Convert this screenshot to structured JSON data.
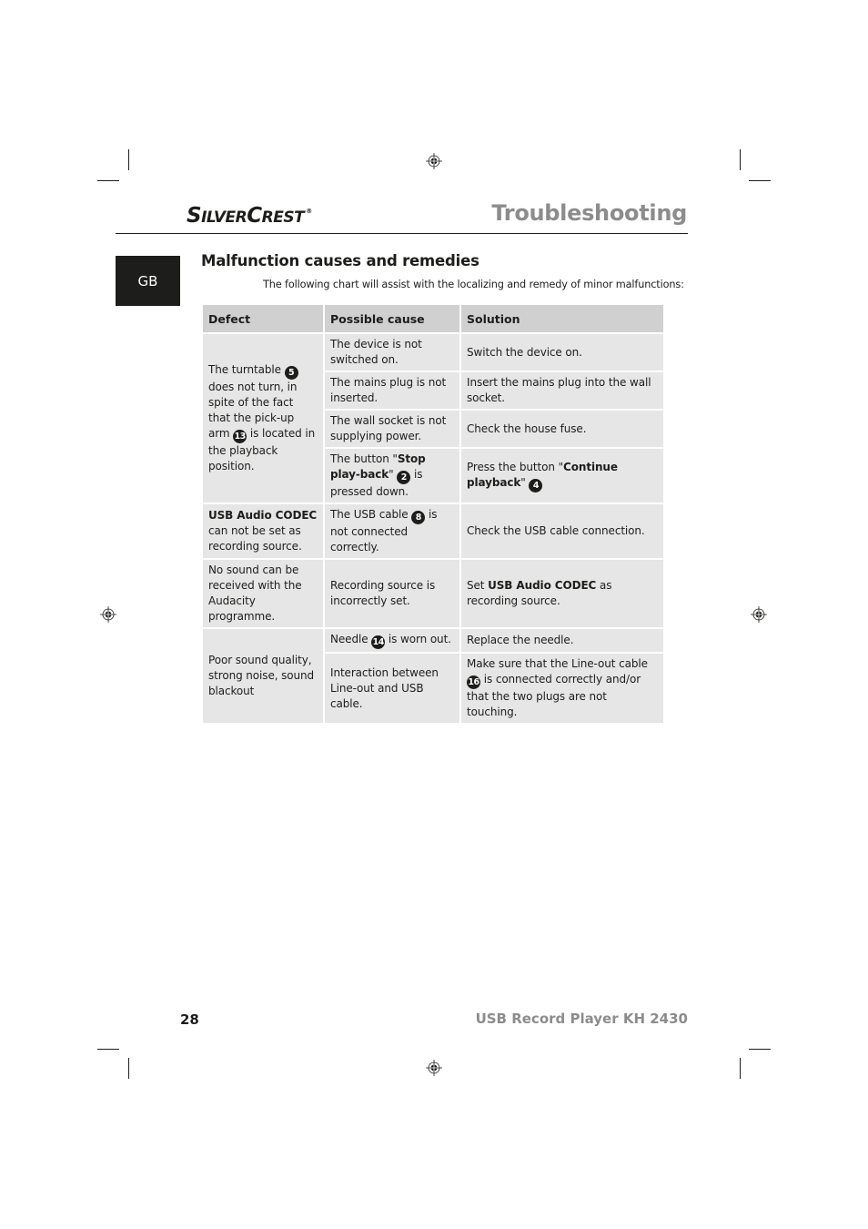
{
  "header": {
    "brand_first_cap": "S",
    "brand_first_rest": "ILVER",
    "brand_second_cap": "C",
    "brand_second_rest": "REST",
    "brand_registered": "®",
    "title": "Troubleshooting"
  },
  "language_tab": "GB",
  "section": {
    "title": "Malfunction causes and remedies",
    "intro": "The following chart will assist with the localizing and remedy of minor malfunctions:"
  },
  "table": {
    "headers": [
      "Defect",
      "Possible cause",
      "Solution"
    ],
    "groups": [
      {
        "defect": {
          "parts": [
            "The turntable ",
            "5",
            " does not turn, in spite of the fact that the pick-up arm ",
            "13",
            " is located in the playback position."
          ]
        },
        "rows": [
          {
            "cause": "The device is not switched on.",
            "solution": "Switch the device on."
          },
          {
            "cause": "The mains plug is not inserted.",
            "solution": "Insert the mains plug into the wall socket."
          },
          {
            "cause": "The wall socket is not supplying power.",
            "solution": "Check the house fuse."
          },
          {
            "cause_parts": [
              "The button \"",
              "Stop play-back",
              "\" ",
              "2",
              " is pressed down."
            ],
            "solution_parts": [
              "Press the button \"",
              "Continue playback",
              "\" ",
              "4"
            ]
          }
        ]
      },
      {
        "defect": {
          "bold": "USB Audio CODEC",
          "rest": " can not be set as recording source."
        },
        "rows": [
          {
            "cause_parts": [
              "The USB cable ",
              "8",
              " is not connected correctly."
            ],
            "solution": "Check the USB cable connection."
          }
        ]
      },
      {
        "defect": {
          "text": "No sound can be received with the Audacity programme."
        },
        "rows": [
          {
            "cause": "Recording source is incorrectly set.",
            "solution_parts": [
              "Set ",
              "USB Audio CODEC",
              " as recording source."
            ]
          }
        ]
      },
      {
        "defect": {
          "text": "Poor sound quality, strong noise, sound blackout"
        },
        "rows": [
          {
            "cause_parts": [
              "Needle ",
              "14",
              " is worn out."
            ],
            "solution": "Replace the needle."
          },
          {
            "cause": "Interaction between Line-out and USB cable.",
            "solution_parts": [
              "Make sure that the Line-out cable ",
              "16",
              " is connected correctly and/or that the two plugs are not touching."
            ]
          }
        ]
      }
    ]
  },
  "footer": {
    "page_number": "28",
    "product": "USB Record Player KH 2430"
  },
  "colors": {
    "text": "#1d1d1b",
    "title_grey": "#8c8c8c",
    "table_header_bg": "#d0d0d0",
    "table_cell_bg": "#e6e6e6"
  }
}
